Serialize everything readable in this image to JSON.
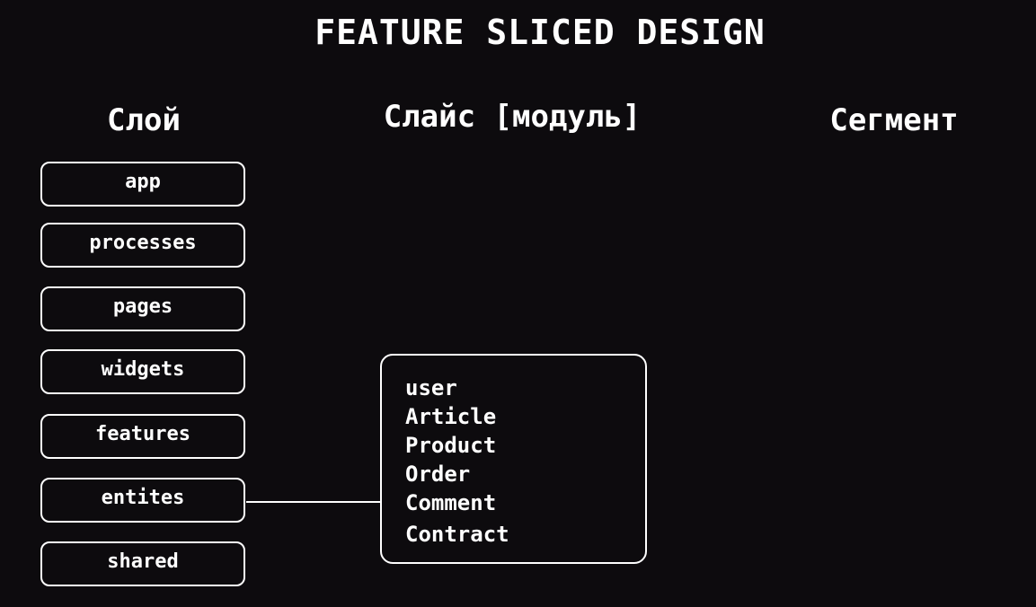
{
  "title": "FEATURE SLICED DESIGN",
  "columns": {
    "layer": "Слой",
    "slice": "Слайс [модуль]",
    "segment": "Сегмент"
  },
  "layers": [
    "app",
    "processes",
    "pages",
    "widgets",
    "features",
    "entites",
    "shared"
  ],
  "slices": [
    "user",
    "Article",
    "Product",
    "Order",
    "Comment",
    "Contract"
  ],
  "colors": {
    "background": "#0d0b0e",
    "foreground": "#ffffff"
  }
}
